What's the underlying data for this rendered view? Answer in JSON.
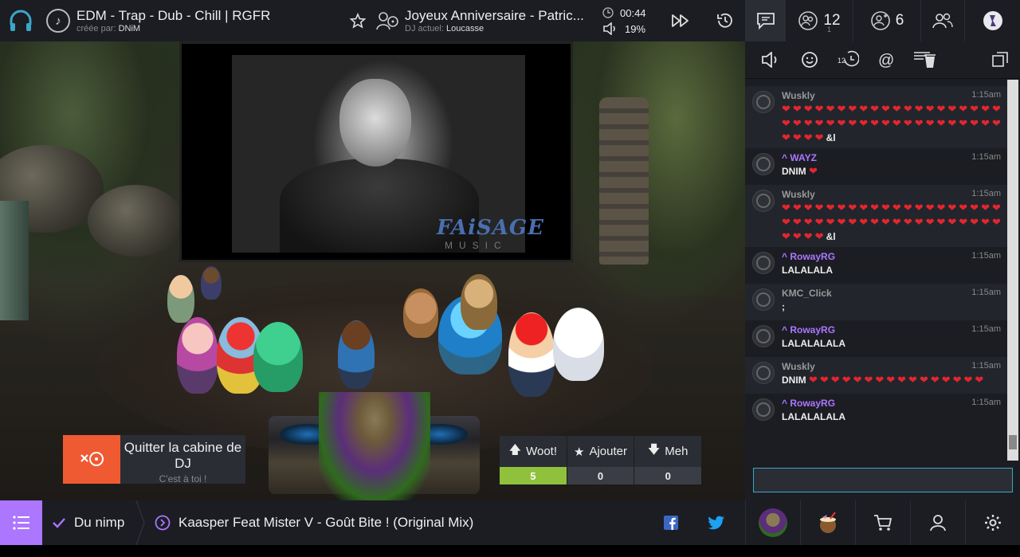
{
  "header": {
    "community_title": "EDM - Trap - Dub - Chill | RGFR",
    "created_by_label": "créée par:",
    "created_by_user": "DNiM",
    "now_playing_title": "Joyeux Anniversaire - Patric...",
    "dj_label": "DJ actuel:",
    "dj_user": "Loucasse",
    "time_remaining": "00:44",
    "volume": "19%",
    "waitlist_count": "12",
    "waitlist_sub": "1",
    "friends_count": "6"
  },
  "icons": {
    "logo": "headphones-icon",
    "note": "music-note-icon",
    "star": "star-icon",
    "dj": "dj-icon",
    "clock": "clock-icon",
    "volume": "volume-icon",
    "skip": "skip-icon",
    "history": "history-icon",
    "chat": "chat-icon",
    "waitlist": "waitlist-icon",
    "friends": "friends-icon",
    "users": "users-icon",
    "profile": "profile-icon"
  },
  "video": {
    "brand_text": "FAiSAGE",
    "brand_sub": "MUSIC"
  },
  "stage": {
    "leave_booth_label": "Quitter la cabine de DJ",
    "leave_booth_sub": "C'est à toi !",
    "woot_label": "Woot!",
    "woot_count": "5",
    "grab_label": "Ajouter",
    "grab_count": "0",
    "meh_label": "Meh",
    "meh_count": "0"
  },
  "chat": {
    "messages": [
      {
        "user": "Wuskly",
        "time": "1:15am",
        "text": "",
        "hearts": "❤❤❤❤❤❤❤❤❤❤❤❤❤❤❤❤❤❤❤❤❤❤❤❤❤❤❤❤❤❤❤❤❤❤❤❤❤❤❤❤❤❤❤❤",
        "suffix": "&l",
        "staff": false,
        "alt": true
      },
      {
        "user": "WAYZ",
        "time": "1:15am",
        "text": "DNIM",
        "hearts": "❤",
        "suffix": "",
        "staff": true,
        "alt": false
      },
      {
        "user": "Wuskly",
        "time": "1:15am",
        "text": "",
        "hearts": "❤❤❤❤❤❤❤❤❤❤❤❤❤❤❤❤❤❤❤❤❤❤❤❤❤❤❤❤❤❤❤❤❤❤❤❤❤❤❤❤❤❤❤❤",
        "suffix": "&l",
        "staff": false,
        "alt": true
      },
      {
        "user": "RowayRG",
        "time": "1:15am",
        "text": "LALALALA",
        "hearts": "",
        "suffix": "",
        "staff": true,
        "alt": false
      },
      {
        "user": "KMC_Click",
        "time": "1:15am",
        "text": ";",
        "hearts": "",
        "suffix": "",
        "staff": false,
        "alt": true
      },
      {
        "user": "RowayRG",
        "time": "1:15am",
        "text": "LALALALALA",
        "hearts": "",
        "suffix": "",
        "staff": true,
        "alt": false
      },
      {
        "user": "Wuskly",
        "time": "1:15am",
        "text": "DNIM",
        "hearts": "❤❤❤❤❤❤❤❤❤❤❤❤❤❤❤❤",
        "suffix": "",
        "staff": false,
        "alt": true
      },
      {
        "user": "RowayRG",
        "time": "1:15am",
        "text": "LALALALALA",
        "hearts": "",
        "suffix": "",
        "staff": true,
        "alt": false
      }
    ],
    "input_placeholder": ""
  },
  "footer": {
    "playlist_name": "Du nimp",
    "next_song": "Kaasper Feat Mister V - Goût Bite ! (Original Mix)"
  },
  "colors": {
    "accent_purple": "#ac76ff",
    "woot_green": "#90c13c",
    "leave_orange": "#f05a33",
    "heart_red": "#e3262e"
  }
}
